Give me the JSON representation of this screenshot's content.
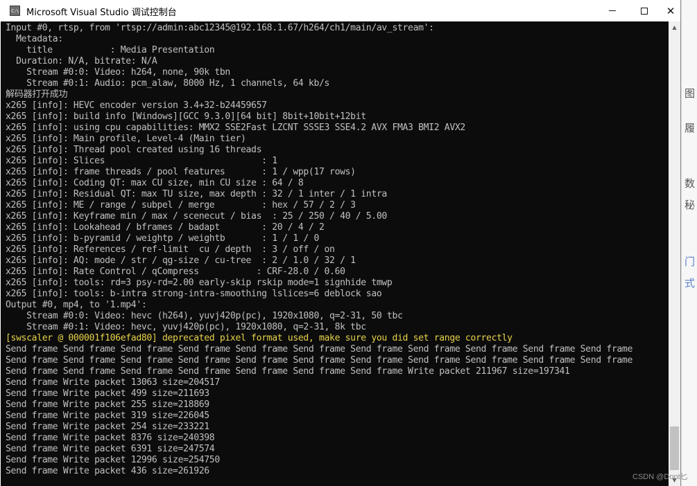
{
  "window": {
    "title": "Microsoft Visual Studio 调试控制台",
    "icon_label": "C:\\",
    "controls": {
      "minimize": "minimize-icon",
      "maximize": "maximize-icon",
      "close": "✕"
    }
  },
  "console": {
    "lines": [
      {
        "text": "Input #0, rtsp, from 'rtsp://admin:abc12345@192.168.1.67/h264/ch1/main/av_stream':"
      },
      {
        "text": "  Metadata:"
      },
      {
        "text": "    title           : Media Presentation"
      },
      {
        "text": "  Duration: N/A, bitrate: N/A"
      },
      {
        "text": "    Stream #0:0: Video: h264, none, 90k tbn"
      },
      {
        "text": "    Stream #0:1: Audio: pcm_alaw, 8000 Hz, 1 channels, 64 kb/s"
      },
      {
        "text": "解码器打开成功"
      },
      {
        "text": "x265 [info]: HEVC encoder version 3.4+32-b24459657"
      },
      {
        "text": "x265 [info]: build info [Windows][GCC 9.3.0][64 bit] 8bit+10bit+12bit"
      },
      {
        "text": "x265 [info]: using cpu capabilities: MMX2 SSE2Fast LZCNT SSSE3 SSE4.2 AVX FMA3 BMI2 AVX2"
      },
      {
        "text": "x265 [info]: Main profile, Level-4 (Main tier)"
      },
      {
        "text": "x265 [info]: Thread pool created using 16 threads"
      },
      {
        "text": "x265 [info]: Slices                              : 1"
      },
      {
        "text": "x265 [info]: frame threads / pool features       : 1 / wpp(17 rows)"
      },
      {
        "text": "x265 [info]: Coding QT: max CU size, min CU size : 64 / 8"
      },
      {
        "text": "x265 [info]: Residual QT: max TU size, max depth : 32 / 1 inter / 1 intra"
      },
      {
        "text": "x265 [info]: ME / range / subpel / merge         : hex / 57 / 2 / 3"
      },
      {
        "text": "x265 [info]: Keyframe min / max / scenecut / bias  : 25 / 250 / 40 / 5.00"
      },
      {
        "text": "x265 [info]: Lookahead / bframes / badapt        : 20 / 4 / 2"
      },
      {
        "text": "x265 [info]: b-pyramid / weightp / weightb       : 1 / 1 / 0"
      },
      {
        "text": "x265 [info]: References / ref-limit  cu / depth  : 3 / off / on"
      },
      {
        "text": "x265 [info]: AQ: mode / str / qg-size / cu-tree  : 2 / 1.0 / 32 / 1"
      },
      {
        "text": "x265 [info]: Rate Control / qCompress           : CRF-28.0 / 0.60"
      },
      {
        "text": "x265 [info]: tools: rd=3 psy-rd=2.00 early-skip rskip mode=1 signhide tmwp"
      },
      {
        "text": "x265 [info]: tools: b-intra strong-intra-smoothing lslices=6 deblock sao"
      },
      {
        "text": "Output #0, mp4, to '1.mp4':"
      },
      {
        "text": "    Stream #0:0: Video: hevc (h264), yuvj420p(pc), 1920x1080, q=2-31, 50 tbc"
      },
      {
        "text": "    Stream #0:1: Video: hevc, yuvj420p(pc), 1920x1080, q=2-31, 8k tbc"
      },
      {
        "text": "[swscaler @ 000001f106efad80] deprecated pixel format used, make sure you did set range correctly",
        "style": "warn"
      },
      {
        "text": "Send frame Send frame Send frame Send frame Send frame Send frame Send frame Send frame Send frame Send frame Send frame"
      },
      {
        "text": "Send frame Send frame Send frame Send frame Send frame Send frame Send frame Send frame Send frame Send frame Send frame"
      },
      {
        "text": "Send frame Send frame Send frame Send frame Send frame Send frame Send frame Write packet 211967 size=197341"
      },
      {
        "text": "Send frame Write packet 13063 size=204517"
      },
      {
        "text": "Send frame Write packet 499 size=211693"
      },
      {
        "text": "Send frame Write packet 255 size=218869"
      },
      {
        "text": "Send frame Write packet 319 size=226045"
      },
      {
        "text": "Send frame Write packet 254 size=233221"
      },
      {
        "text": "Send frame Write packet 8376 size=240398"
      },
      {
        "text": "Send frame Write packet 6391 size=247574"
      },
      {
        "text": "Send frame Write packet 12996 size=254750"
      },
      {
        "text": "Send frame Write packet 436 size=261926"
      }
    ]
  },
  "scrollbar": {
    "up_icon": "▲",
    "down_icon": "▼"
  },
  "background_app": {
    "glyphs": [
      "图",
      "履",
      "数",
      "秘",
      "门",
      "式"
    ]
  },
  "watermark": "CSDN @Dont匕",
  "colors": {
    "console_bg": "#0c0c0c",
    "console_text": "#c0c0c0",
    "warning_text": "#e8d34b"
  }
}
